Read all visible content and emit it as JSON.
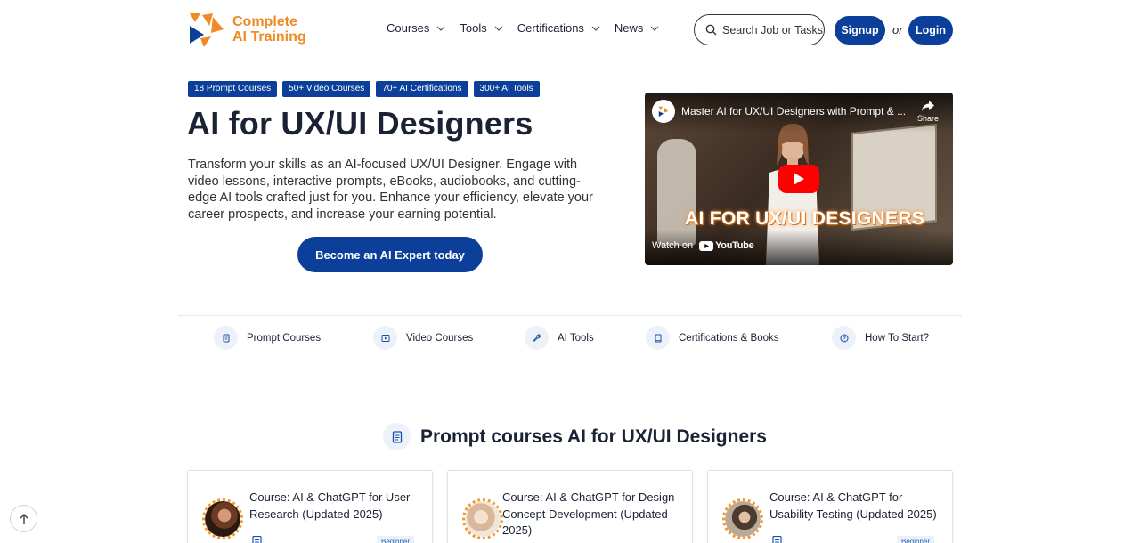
{
  "brand": {
    "line1": "Complete",
    "line2": "AI Training",
    "colors": {
      "orange": "#f08a24",
      "navy": "#0b3f9a"
    }
  },
  "nav": {
    "items": [
      {
        "label": "Courses",
        "icon": "chevron-down-icon"
      },
      {
        "label": "Tools",
        "icon": "chevron-down-icon"
      },
      {
        "label": "Certifications",
        "icon": "chevron-down-icon"
      },
      {
        "label": "News",
        "icon": "chevron-down-icon"
      }
    ],
    "search_label": "Search Job or Tasks",
    "signup_label": "Signup",
    "or_label": "or",
    "login_label": "Login"
  },
  "hero": {
    "badges": [
      "18 Prompt Courses",
      "50+ Video Courses",
      "70+ AI Certifications",
      "300+ AI Tools"
    ],
    "title": "AI for UX/UI Designers",
    "description": "Transform your skills as an AI-focused UX/UI Designer. Engage with video lessons, interactive prompts, eBooks, audiobooks, and cutting-edge AI tools crafted just for you. Enhance your efficiency, elevate your career prospects, and increase your earning potential.",
    "cta_label": "Become an AI Expert today"
  },
  "video": {
    "title": "Master AI for UX/UI Designers with Prompt & ...",
    "share_label": "Share",
    "overlay_text": "AI FOR UX/UI DESIGNERS",
    "watch_on": "Watch on",
    "youtube_label": "YouTube"
  },
  "quicklinks": [
    {
      "label": "Prompt Courses",
      "icon": "document-icon"
    },
    {
      "label": "Video Courses",
      "icon": "play-icon"
    },
    {
      "label": "AI Tools",
      "icon": "wrench-icon"
    },
    {
      "label": "Certifications & Books",
      "icon": "book-icon"
    },
    {
      "label": "How To Start?",
      "icon": "question-icon"
    }
  ],
  "section": {
    "title": "Prompt courses AI for UX/UI Designers"
  },
  "cards": [
    {
      "title": "Course: AI & ChatGPT for User Research (Updated 2025)",
      "level": "Beginner"
    },
    {
      "title": "Course: AI & ChatGPT for Design Concept Development (Updated 2025)",
      "level": ""
    },
    {
      "title": "Course: AI & ChatGPT for Usability Testing (Updated 2025)",
      "level": "Beginner"
    }
  ]
}
